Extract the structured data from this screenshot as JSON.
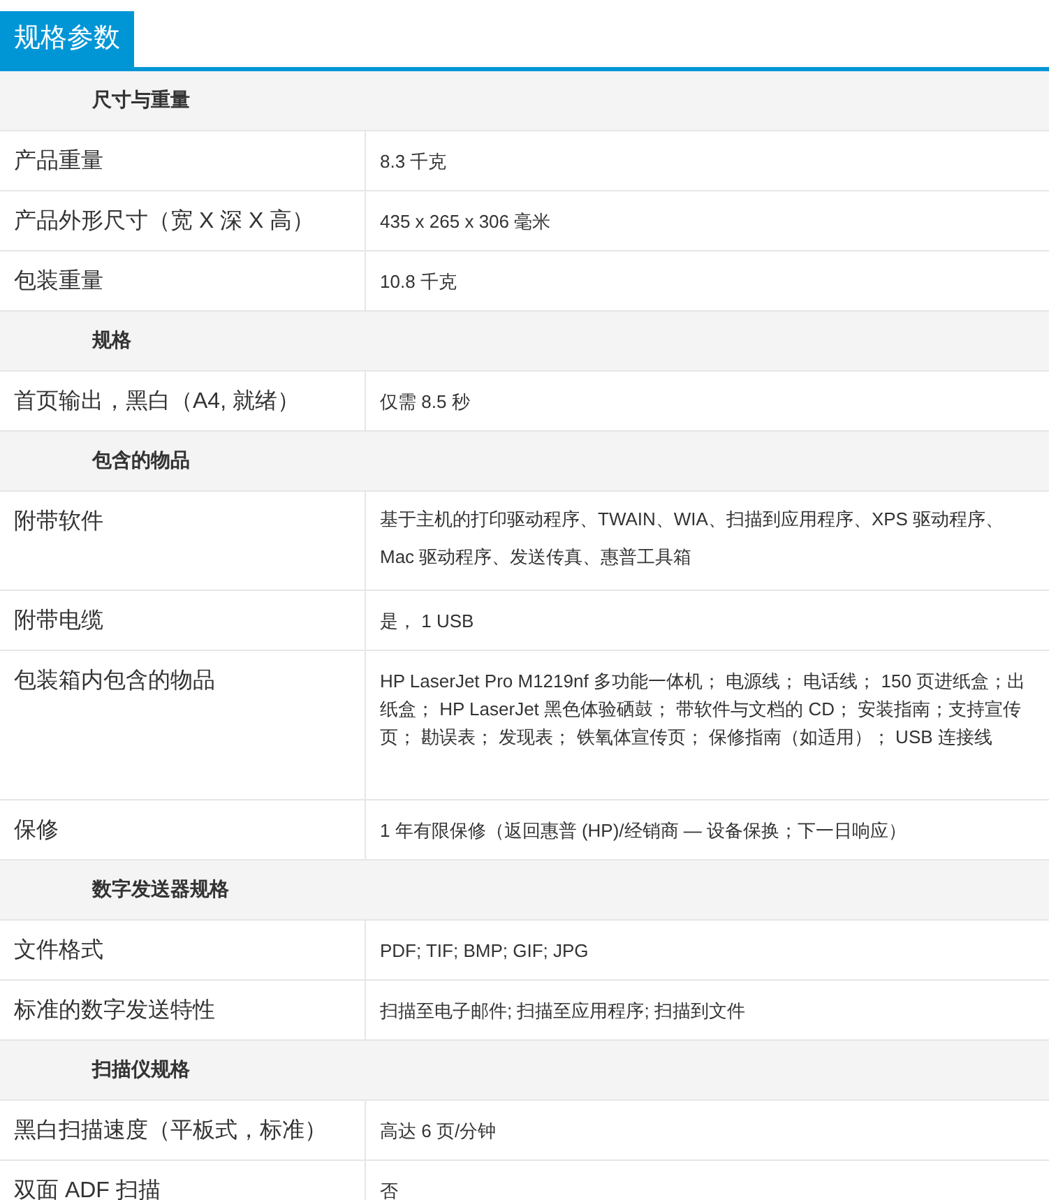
{
  "tab": {
    "label": "规格参数",
    "selected": true
  },
  "sections": [
    {
      "title": "尺寸与重量",
      "rows": [
        {
          "label": "产品重量",
          "value": "8.3 千克"
        },
        {
          "label": "产品外形尺寸（宽 X 深 X 高）",
          "value": "435 x 265 x 306 毫米"
        },
        {
          "label": "包装重量",
          "value": "10.8 千克"
        }
      ]
    },
    {
      "title": "规格",
      "rows": [
        {
          "label": "首页输出，黑白（A4, 就绪）",
          "value": "仅需 8.5 秒"
        }
      ]
    },
    {
      "title": "包含的物品",
      "rows": [
        {
          "label": "附带软件",
          "value": "基于主机的打印驱动程序、TWAIN、WIA、扫描到应用程序、XPS 驱动程序、Mac 驱动程序、发送传真、惠普工具箱",
          "kind": "loose"
        },
        {
          "label": "附带电缆",
          "value": "是， 1 USB"
        },
        {
          "label": "包装箱内包含的物品",
          "value": "HP LaserJet Pro M1219nf 多功能一体机； 电源线； 电话线； 150 页进纸盒；出纸盒； HP LaserJet 黑色体验硒鼓； 带软件与文档的 CD； 安装指南；支持宣传页； 勘误表； 发现表； 铁氧体宣传页； 保修指南（如适用）； USB 连接线",
          "kind": "tall"
        },
        {
          "label": "保修",
          "value": "1 年有限保修（返回惠普 (HP)/经销商 — 设备保换；下一日响应）"
        }
      ]
    },
    {
      "title": "数字发送器规格",
      "rows": [
        {
          "label": "文件格式",
          "value": "PDF; TIF; BMP; GIF; JPG"
        },
        {
          "label": "标准的数字发送特性",
          "value": "扫描至电子邮件; 扫描至应用程序; 扫描到文件"
        }
      ]
    },
    {
      "title": "扫描仪规格",
      "rows": [
        {
          "label": "黑白扫描速度（平板式，标准）",
          "value": "高达 6 页/分钟"
        },
        {
          "label": "双面 ADF 扫描",
          "value": "否"
        }
      ]
    }
  ]
}
